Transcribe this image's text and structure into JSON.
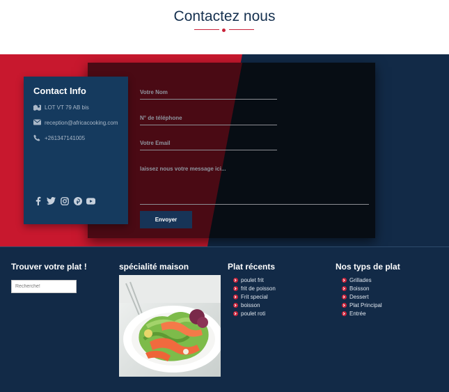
{
  "header": {
    "title": "Contactez nous"
  },
  "contact_info": {
    "title": "Contact Info",
    "address": "LOT VT 79 AB bis",
    "email": "reception@africacooking.com",
    "phone": "+261347141005",
    "social_icons": [
      "facebook-icon",
      "twitter-icon",
      "instagram-icon",
      "pinterest-icon",
      "youtube-icon"
    ]
  },
  "form": {
    "name_label": "Votre Nom",
    "phone_label": "N° de téléphone",
    "email_label": "Votre Email",
    "message_label": "laissez nous votre message ici...",
    "submit_label": "Envoyer"
  },
  "footer": {
    "search": {
      "title": "Trouver votre plat !",
      "placeholder": "Recherche!"
    },
    "specialty": {
      "title": "spécialité maison"
    },
    "recent": {
      "title": "Plat récents",
      "items": [
        "poulet frit",
        "frit de poisson",
        "Frit special",
        "boisson",
        "poulet roti"
      ]
    },
    "types": {
      "title": "Nos typs de plat",
      "items": [
        "Grillades",
        "Boisson",
        "Dessert",
        "Plat Principal",
        "Entrée"
      ]
    }
  },
  "colors": {
    "accent": "#c9233a",
    "navy": "#122a47",
    "card": "#153a5e",
    "dark_panel": "#070d14",
    "dark_red": "#4a0a14"
  }
}
